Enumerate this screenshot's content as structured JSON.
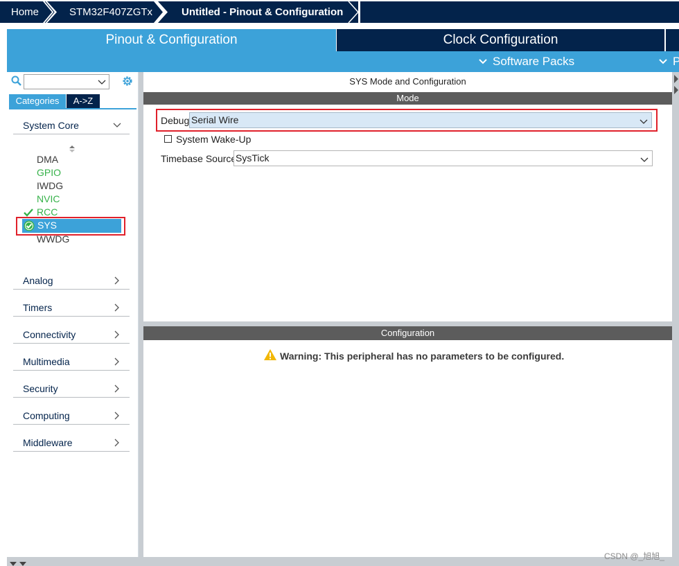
{
  "breadcrumb": {
    "home": "Home",
    "mcu": "STM32F407ZGTx",
    "project": "Untitled - Pinout & Configuration"
  },
  "tabs": {
    "pinout": "Pinout & Configuration",
    "clock": "Clock Configuration",
    "software_packs": "Software Packs",
    "overflow": "P"
  },
  "left_panel": {
    "search_value": "",
    "tab_categories": "Categories",
    "tab_az": "A->Z",
    "categories": [
      {
        "label": "System Core",
        "expanded": true
      },
      {
        "label": "Analog"
      },
      {
        "label": "Timers"
      },
      {
        "label": "Connectivity"
      },
      {
        "label": "Multimedia"
      },
      {
        "label": "Security"
      },
      {
        "label": "Computing"
      },
      {
        "label": "Middleware"
      }
    ],
    "peripherals": [
      {
        "label": "DMA",
        "state": "default"
      },
      {
        "label": "GPIO",
        "state": "green"
      },
      {
        "label": "IWDG",
        "state": "default"
      },
      {
        "label": "NVIC",
        "state": "green"
      },
      {
        "label": "RCC",
        "state": "checked"
      },
      {
        "label": "SYS",
        "state": "selected"
      },
      {
        "label": "WWDG",
        "state": "default"
      }
    ]
  },
  "main_panel": {
    "title": "SYS Mode and Configuration",
    "mode_header": "Mode",
    "debug_label": "Debug",
    "debug_value": "Serial Wire",
    "wakeup_label": "System Wake-Up",
    "wakeup_checked": false,
    "timebase_label": "Timebase Source",
    "timebase_value": "SysTick",
    "config_header": "Configuration",
    "warning": "Warning: This peripheral has no parameters to be configured."
  },
  "watermark": "CSDN @_旭旭_",
  "colors": {
    "navy": "#03234b",
    "accent_blue": "#3ca2d9",
    "green": "#36b24a",
    "highlight_red": "#e0202a",
    "warning_yellow": "#f2b705"
  },
  "icons": [
    "search-icon",
    "gear-icon",
    "chevron-down-icon",
    "chevron-right-icon",
    "check-icon",
    "check-circle-icon",
    "warning-icon",
    "sort-icon"
  ]
}
